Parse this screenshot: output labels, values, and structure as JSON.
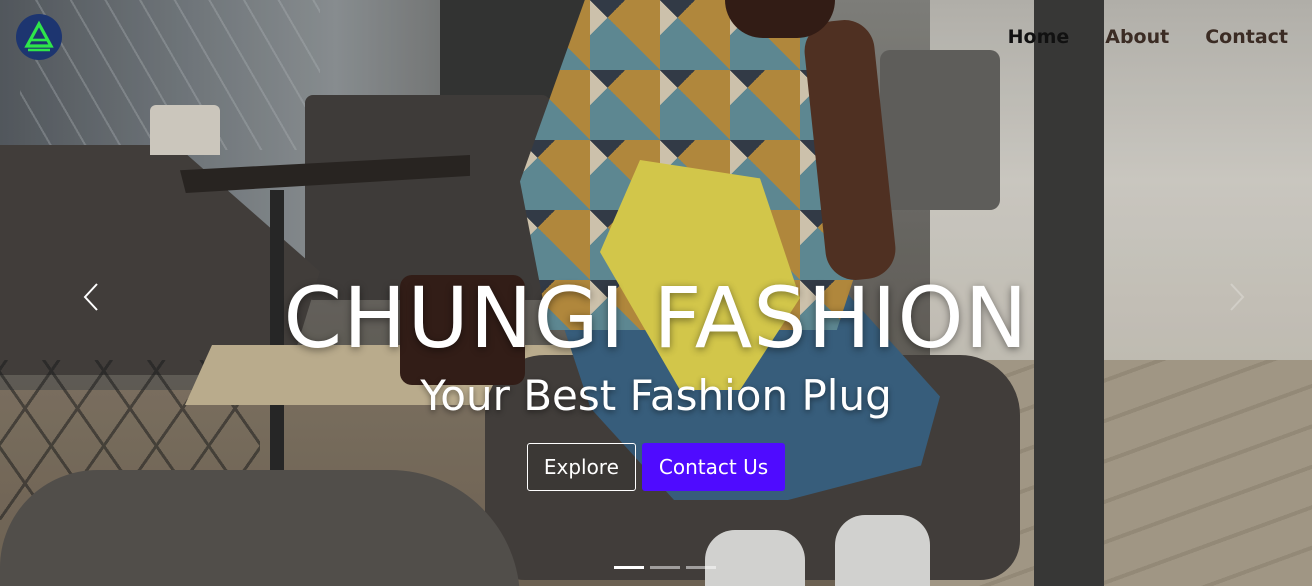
{
  "nav": {
    "logo_icon": "brand-triangle-logo",
    "items": [
      {
        "label": "Home",
        "active": true
      },
      {
        "label": "About",
        "active": false
      },
      {
        "label": "Contact",
        "active": false
      }
    ]
  },
  "hero": {
    "title": "CHUNGI FASHION",
    "subtitle": "Your Best Fashion Plug",
    "explore_label": "Explore",
    "contact_label": "Contact Us"
  },
  "carousel": {
    "prev_icon": "chevron-left-icon",
    "next_icon": "chevron-right-icon",
    "slide_count": 3,
    "active_slide": 1
  },
  "colors": {
    "primary": "#4f0bff",
    "logo_bg": "#1d3570",
    "logo_mark": "#2ee64a"
  }
}
